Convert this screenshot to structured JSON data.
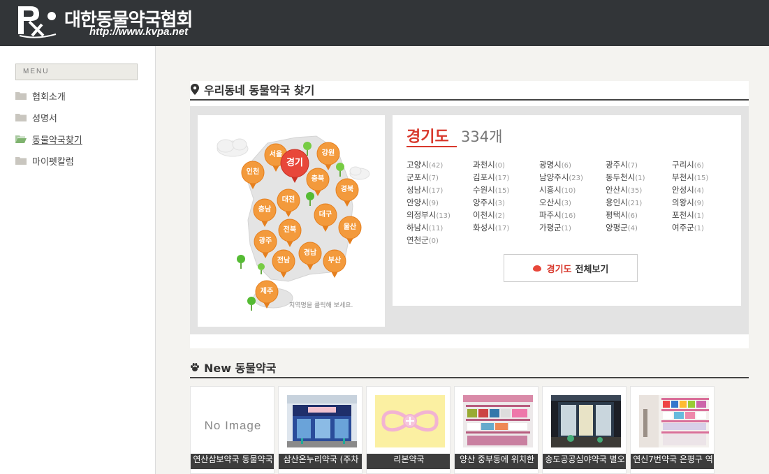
{
  "header": {
    "logo_text": "대한동물약국협회",
    "logo_url": "http://www.kvpa.net"
  },
  "sidebar": {
    "menu_label": "MENU",
    "items": [
      {
        "label": "협회소개",
        "active": false
      },
      {
        "label": "성명서",
        "active": false
      },
      {
        "label": "동물약국찾기",
        "active": true
      },
      {
        "label": "마이펫칼럼",
        "active": false
      }
    ]
  },
  "finder": {
    "title": "우리동네 동물약국 찾기",
    "map_hint": "지역명을 클릭해 보세요.",
    "regions": [
      "서울",
      "경기",
      "강원",
      "인천",
      "충북",
      "경북",
      "대전",
      "충남",
      "대구",
      "전북",
      "울산",
      "광주",
      "경남",
      "전남",
      "부산",
      "제주"
    ],
    "selected_region": "경기",
    "province_name": "경기도",
    "province_count": "334개",
    "cities": [
      {
        "name": "고양시",
        "count": "(42)"
      },
      {
        "name": "과천시",
        "count": "(0)"
      },
      {
        "name": "광명시",
        "count": "(6)"
      },
      {
        "name": "광주시",
        "count": "(7)"
      },
      {
        "name": "구리시",
        "count": "(6)"
      },
      {
        "name": "군포시",
        "count": "(7)"
      },
      {
        "name": "김포시",
        "count": "(17)"
      },
      {
        "name": "남양주시",
        "count": "(23)"
      },
      {
        "name": "동두천시",
        "count": "(1)"
      },
      {
        "name": "부천시",
        "count": "(15)"
      },
      {
        "name": "성남시",
        "count": "(17)"
      },
      {
        "name": "수원시",
        "count": "(15)"
      },
      {
        "name": "시흥시",
        "count": "(10)"
      },
      {
        "name": "안산시",
        "count": "(35)"
      },
      {
        "name": "안성시",
        "count": "(4)"
      },
      {
        "name": "안양시",
        "count": "(9)"
      },
      {
        "name": "양주시",
        "count": "(3)"
      },
      {
        "name": "오산시",
        "count": "(3)"
      },
      {
        "name": "용인시",
        "count": "(21)"
      },
      {
        "name": "의왕시",
        "count": "(9)"
      },
      {
        "name": "의정부시",
        "count": "(13)"
      },
      {
        "name": "이천시",
        "count": "(2)"
      },
      {
        "name": "파주시",
        "count": "(16)"
      },
      {
        "name": "평택시",
        "count": "(6)"
      },
      {
        "name": "포천시",
        "count": "(1)"
      },
      {
        "name": "하남시",
        "count": "(11)"
      },
      {
        "name": "화성시",
        "count": "(17)"
      },
      {
        "name": "가평군",
        "count": "(1)"
      },
      {
        "name": "양평군",
        "count": "(4)"
      },
      {
        "name": "여주군",
        "count": "(1)"
      },
      {
        "name": "연천군",
        "count": "(0)"
      }
    ],
    "view_all_region": "경기도",
    "view_all_label": "전체보기"
  },
  "new_pharmacies": {
    "title": "New 동물약국",
    "no_image_label": "No Image",
    "items": [
      {
        "name": "연산삼보약국 동물약국"
      },
      {
        "name": "삼산온누리약국 (주차"
      },
      {
        "name": "리본약국"
      },
      {
        "name": "양산 중부동에 위치한"
      },
      {
        "name": "송도공공심야약국 별오"
      },
      {
        "name": "연신7번약국 은평구 역"
      }
    ]
  },
  "colors": {
    "header_bg": "#323538",
    "accent_red": "#d8382c",
    "pin_orange": "#f39a3c"
  }
}
